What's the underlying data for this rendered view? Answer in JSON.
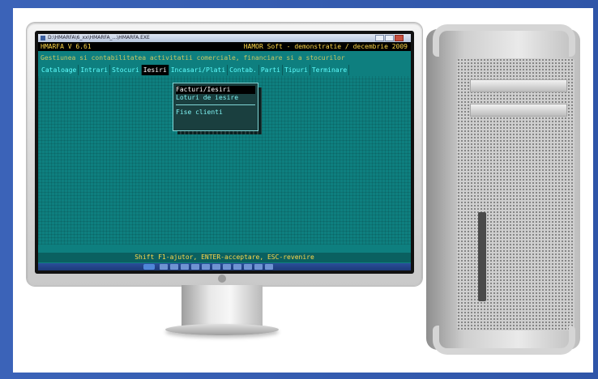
{
  "window": {
    "title": "D:\\HMARFA\\6_xx\\HMARFA_...\\HMARFA.EXE"
  },
  "app": {
    "version": "HMARFA V 6.61",
    "company": "HAMOR Soft - demonstratie / decembrie 2009",
    "subtitle": "Gestiunea si contabilitatea activitatii comerciale, financiare si a stocurilor"
  },
  "menu": {
    "items": [
      {
        "label": "Cataloage"
      },
      {
        "label": "Intrari"
      },
      {
        "label": "Stocuri"
      },
      {
        "label": "Iesiri",
        "active": true
      },
      {
        "label": "Incasari/Plati"
      },
      {
        "label": "Contab."
      },
      {
        "label": "Parti"
      },
      {
        "label": "Tipuri"
      },
      {
        "label": "Terminare"
      }
    ]
  },
  "dropdown": {
    "items": [
      {
        "label": "Facturi/Iesiri",
        "selected": true
      },
      {
        "label": "Loturi de iesire"
      },
      {
        "label": "Fise clienti"
      }
    ]
  },
  "status": {
    "text": "Shift F1-ajutor, ENTER-acceptare, ESC-revenire"
  },
  "colors": {
    "screen_bg": "#0e7f7f",
    "text_cyan": "#5fffff",
    "text_yellow": "#ffd84a",
    "page_bg": "#2f55a8"
  },
  "icons": [
    "app-icon",
    "apple-logo-icon",
    "start-button-icon"
  ]
}
